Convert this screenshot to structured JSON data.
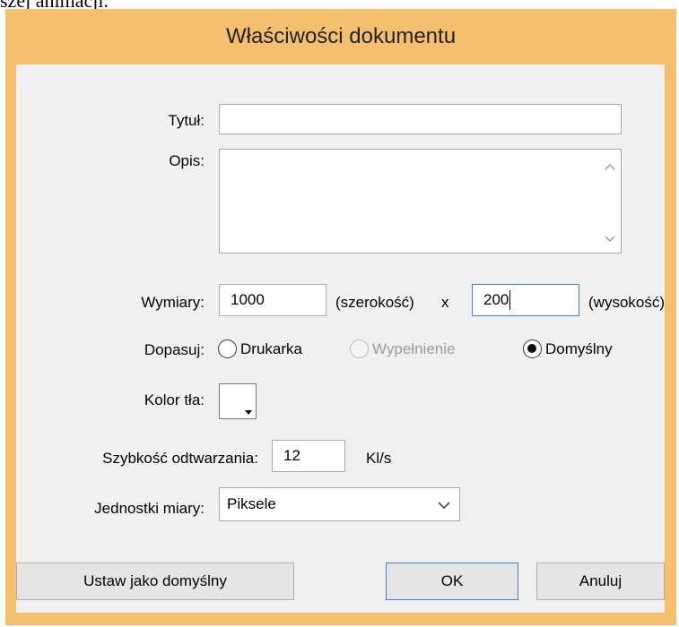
{
  "background": {
    "caption": "szej animacji."
  },
  "dialog": {
    "title": "Właściwości dokumentu",
    "title_label": "Tytuł:",
    "title_value": "",
    "description_label": "Opis:",
    "description_value": "",
    "dimensions": {
      "label": "Wymiary:",
      "width_value": "1000",
      "width_unit": "(szerokość)",
      "times": "x",
      "height_value": "200",
      "height_unit": "(wysokość)"
    },
    "fit": {
      "label": "Dopasuj:",
      "options": [
        {
          "label": "Drukarka",
          "selected": false,
          "enabled": true
        },
        {
          "label": "Wypełnienie",
          "selected": false,
          "enabled": false
        },
        {
          "label": "Domyślny",
          "selected": true,
          "enabled": true
        }
      ]
    },
    "background_color": {
      "label": "Kolor tła:",
      "value": "#ffffff"
    },
    "frame_rate": {
      "label": "Szybkość odtwarzania:",
      "value": "12",
      "unit": "Kl/s"
    },
    "units": {
      "label": "Jednostki miary:",
      "selected": "Piksele"
    },
    "buttons": {
      "set_default": "Ustaw jako domyślny",
      "ok": "OK",
      "cancel": "Anuluj"
    },
    "colors": {
      "frame": "#f4c06e",
      "client": "#f0f0f0",
      "focus": "#3a84d8"
    }
  }
}
